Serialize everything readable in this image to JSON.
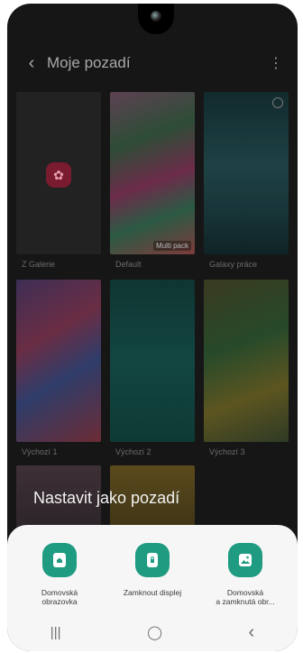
{
  "header": {
    "title": "Moje pozadí"
  },
  "wallpapers": [
    {
      "caption": "Z Galerie"
    },
    {
      "caption": "Default",
      "badge": "Multi pack"
    },
    {
      "caption": "Galaxy práce"
    },
    {
      "caption": "Výchozí 1"
    },
    {
      "caption": "Výchozí 2"
    },
    {
      "caption": "Výchozí 3"
    }
  ],
  "sheet": {
    "heading": "Nastavit jako pozadí",
    "options": [
      {
        "label": "Domovská\nobrazovka",
        "icon": "home-screen-icon"
      },
      {
        "label": "Zamknout displej",
        "icon": "lock-screen-icon"
      },
      {
        "label": "Domovská\na zamknutá obr...",
        "icon": "image-icon"
      }
    ]
  },
  "nav": {
    "recents": "|||",
    "home": "◯",
    "back": "‹"
  },
  "colors": {
    "accent": "#1f9b82"
  }
}
